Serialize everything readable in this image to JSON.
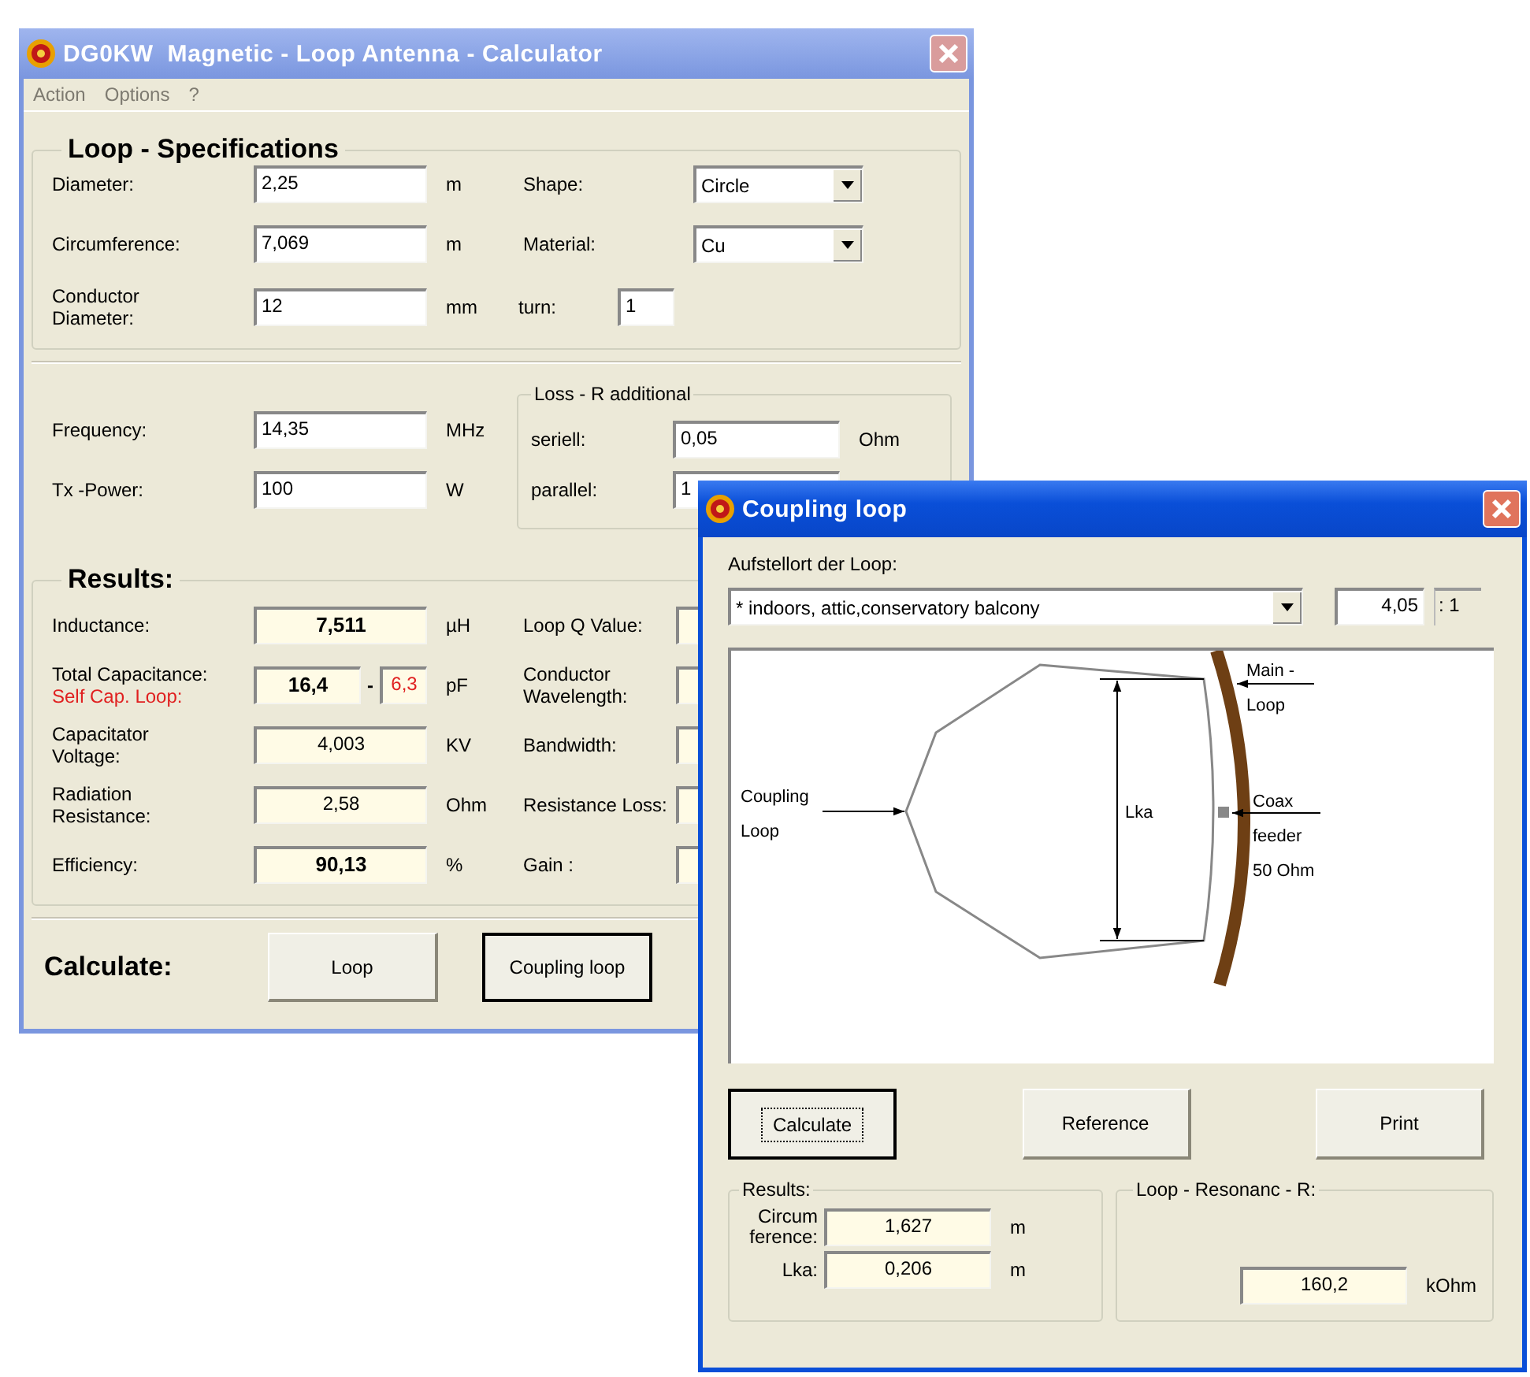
{
  "main_window": {
    "title": "DG0KW  Magnetic - Loop Antenna - Calculator",
    "menu": [
      {
        "label": "Action",
        "disabled": true
      },
      {
        "label": "Options",
        "disabled": true
      },
      {
        "label": "?",
        "disabled": true
      }
    ],
    "loop_specifications": {
      "title": "Loop - Specifications",
      "rows": [
        {
          "label": "Diameter:",
          "value": "2,25",
          "unit": "m"
        },
        {
          "label": "Circumference:",
          "value": "7,069",
          "unit": "m"
        },
        {
          "label": "Conductor Diameter:",
          "value": "12",
          "unit": "mm"
        }
      ],
      "settings": [
        {
          "kind": "combo",
          "label": "Shape:",
          "value": "Circle"
        },
        {
          "kind": "combo",
          "label": "Material:",
          "value": "Cu"
        },
        {
          "kind": "field",
          "label": "turn:",
          "value": "1"
        }
      ]
    },
    "operation": {
      "rows": [
        {
          "label": "Frequency:",
          "value": "14,35",
          "unit": "MHz"
        },
        {
          "label": "Tx -Power:",
          "value": "100",
          "unit": "W"
        }
      ],
      "loss_r": {
        "title": "Loss - R additional",
        "rows": [
          {
            "label": "seriell:",
            "value": "0,05",
            "unit": "Ohm"
          },
          {
            "label": "parallel:",
            "value": "1"
          }
        ]
      }
    },
    "results": {
      "title": "Results:",
      "rows": [
        {
          "label": "Inductance:",
          "value": "7,511",
          "unit": "µH",
          "emphasis": true
        },
        {
          "label": "Total Capacitance:",
          "sublabel": "Self Cap. Loop:",
          "value": "16,4",
          "separator": "-",
          "secondary_value": "6,3",
          "unit": "pF",
          "emphasis": true
        },
        {
          "label": "Capacitator Voltage:",
          "value": "4,003",
          "unit": "KV",
          "emphasis": false
        },
        {
          "label": "Radiation Resistance:",
          "value": "2,58",
          "unit": "Ohm",
          "emphasis": false
        },
        {
          "label": "Efficiency:",
          "value": "90,13",
          "unit": "%",
          "emphasis": true
        }
      ],
      "side_labels": [
        "Loop Q Value:",
        "Conductor Wavelength:",
        "Bandwidth:",
        "Resistance Loss:",
        "Gain :"
      ]
    },
    "calculate": {
      "label": "Calculate:",
      "buttons": [
        {
          "label": "Loop",
          "focused": false
        },
        {
          "label": "Coupling loop",
          "focused": true
        }
      ]
    }
  },
  "coupling_window": {
    "title": "Coupling loop",
    "location_label": "Aufstellort der Loop:",
    "location": "* indoors, attic,conservatory balcony",
    "ratio": "4,05",
    "ratio_suffix": ": 1",
    "diagram": {
      "coupling_label": [
        "Coupling",
        "Loop"
      ],
      "dimension_label": "Lka",
      "main_loop_label": [
        "Main -",
        "Loop"
      ],
      "feeder_label": [
        "Coax",
        "feeder",
        "50 Ohm"
      ]
    },
    "buttons": [
      {
        "label": "Calculate",
        "focused": true
      },
      {
        "label": "Reference",
        "focused": false
      },
      {
        "label": "Print",
        "focused": false
      }
    ],
    "results": {
      "title": "Results:",
      "rows": [
        {
          "label": "Circum ference:",
          "value": "1,627",
          "unit": "m"
        },
        {
          "label": "Lka:",
          "value": "0,206",
          "unit": "m"
        }
      ]
    },
    "resonance": {
      "title": "Loop - Resonanc - R:",
      "value": "160,2",
      "unit": "kOhm"
    }
  }
}
